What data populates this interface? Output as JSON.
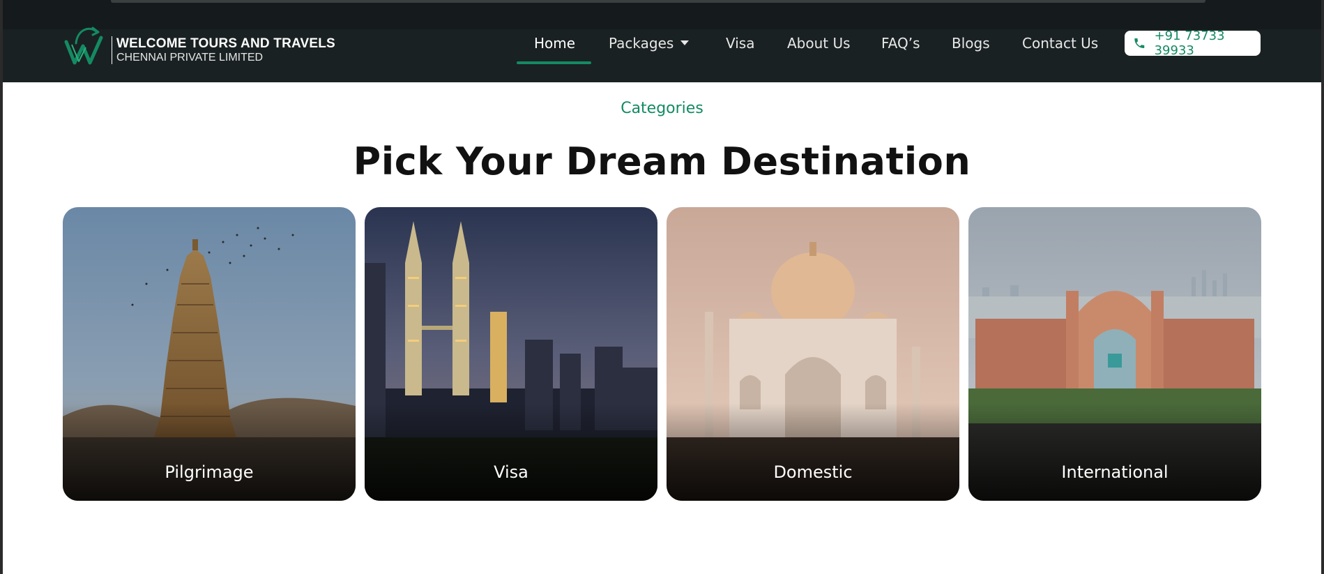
{
  "brand": {
    "name_line1": "WELCOME TOURS AND TRAVELS",
    "name_line2": "CHENNAI PRIVATE LIMITED",
    "logo_icon": "ww-swoosh-logo",
    "accent": "#148a62"
  },
  "nav": {
    "items": [
      {
        "label": "Home",
        "active": true
      },
      {
        "label": "Packages",
        "has_dropdown": true
      },
      {
        "label": "Visa"
      },
      {
        "label": "About Us"
      },
      {
        "label": "FAQ’s"
      },
      {
        "label": "Blogs"
      },
      {
        "label": "Contact Us"
      }
    ],
    "phone": {
      "icon": "phone-icon",
      "label": "+91 73733 39933"
    }
  },
  "section": {
    "eyebrow": "Categories",
    "title": "Pick Your Dream Destination"
  },
  "categories": [
    {
      "label": "Pilgrimage",
      "image": "temple-tower"
    },
    {
      "label": "Visa",
      "image": "twin-towers-skyline"
    },
    {
      "label": "Domestic",
      "image": "taj-mahal"
    },
    {
      "label": "International",
      "image": "atlantis-resort"
    }
  ],
  "colors": {
    "header_bg": "#1a2122",
    "accent_green": "#148a62",
    "heading": "#111111"
  }
}
